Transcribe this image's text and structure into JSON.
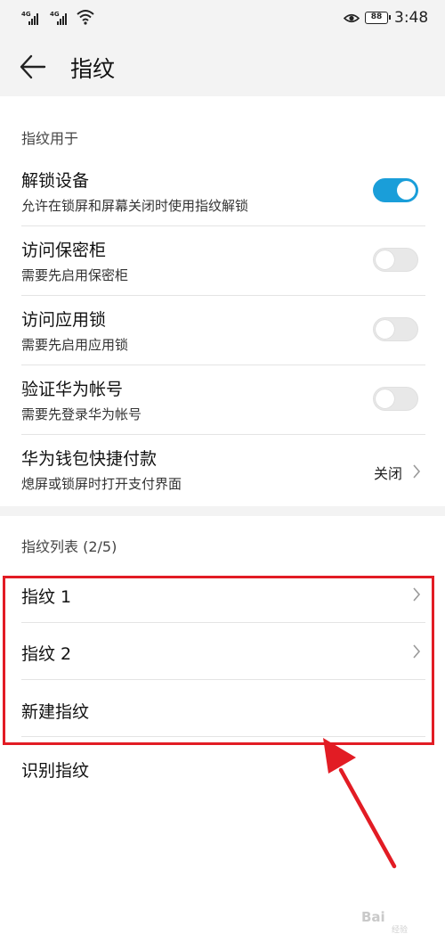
{
  "status_bar": {
    "sim1_label": "4G",
    "sim2_label": "4G",
    "battery": "88",
    "time": "3:48",
    "icons": [
      "signal-icon",
      "signal-icon",
      "wifi-icon",
      "eye-icon",
      "battery-icon"
    ]
  },
  "header": {
    "title": "指纹",
    "back_icon": "back-arrow-icon"
  },
  "section_usage": {
    "label": "指纹用于",
    "items": [
      {
        "title": "解锁设备",
        "subtitle": "允许在锁屏和屏幕关闭时使用指纹解锁",
        "toggle": "on"
      },
      {
        "title": "访问保密柜",
        "subtitle": "需要先启用保密柜",
        "toggle": "off"
      },
      {
        "title": "访问应用锁",
        "subtitle": "需要先启用应用锁",
        "toggle": "off"
      },
      {
        "title": "验证华为帐号",
        "subtitle": "需要先登录华为帐号",
        "toggle": "off"
      },
      {
        "title": "华为钱包快捷付款",
        "subtitle": "熄屏或锁屏时打开支付界面",
        "value": "关闭"
      }
    ]
  },
  "section_list": {
    "label": "指纹列表 (2/5)",
    "items": [
      {
        "title": "指纹 1"
      },
      {
        "title": "指纹 2"
      },
      {
        "title": "新建指纹"
      },
      {
        "title": "识别指纹"
      }
    ]
  },
  "colors": {
    "toggle_on": "#1a9ed9",
    "highlight": "#e21c24",
    "annotation_arrow": "#e21c24",
    "band": "#f3f3f3"
  },
  "watermark": {
    "text": "Bai",
    "sub": "经验"
  }
}
